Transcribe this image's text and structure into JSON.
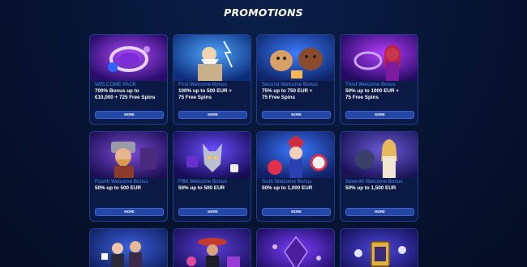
{
  "page_title": "PROMOTIONS",
  "more_label": "MORE",
  "cards": [
    {
      "label": "WELCOME PACK",
      "desc_1": "700% Bonus up to",
      "desc_2": "€10,000 + 725 Free Spins",
      "art": "ring-art-icon",
      "bg": "#5a1fa8"
    },
    {
      "label": "First Welcome Bonus",
      "desc_1": "100% up to 500 EUR +",
      "desc_2": "75 Free Spins",
      "art": "zeus-art-icon",
      "bg": "#1d4fb8"
    },
    {
      "label": "Second Welcome Bonus",
      "desc_1": "75% up to 750 EUR +",
      "desc_2": "75 Free Spins",
      "art": "dogs-art-icon",
      "bg": "#1b3f9a"
    },
    {
      "label": "Third Welcome Bonus",
      "desc_1": "50% up to 1000 EUR +",
      "desc_2": "75 Free Spins",
      "art": "sorceress-art-icon",
      "bg": "#4a1c8e"
    },
    {
      "label": "Fourth Welcome Bonus",
      "desc_1": "50% up to 500 EUR",
      "desc_2": "",
      "art": "viking-art-icon",
      "bg": "#3a1a7a"
    },
    {
      "label": "Fifth Welcome Bonus",
      "desc_1": "50% up to 500 EUR",
      "desc_2": "",
      "art": "wolf-art-icon",
      "bg": "#2a1a7e"
    },
    {
      "label": "Sixth Welcome Bonus",
      "desc_1": "50% up to 1,000 EUR",
      "desc_2": "",
      "art": "jester-art-icon",
      "bg": "#24318e"
    },
    {
      "label": "Seventh Welcome Bonus",
      "desc_1": "50% up to 1,500 EUR",
      "desc_2": "",
      "art": "goddess-art-icon",
      "bg": "#2b2a7a"
    },
    {
      "art": "card-players-art-icon",
      "bg": "#1d2f80"
    },
    {
      "art": "mariachi-art-icon",
      "bg": "#2d1f86"
    },
    {
      "art": "crystal-art-icon",
      "bg": "#321a8a"
    },
    {
      "art": "treasure-art-icon",
      "bg": "#281c84"
    }
  ]
}
